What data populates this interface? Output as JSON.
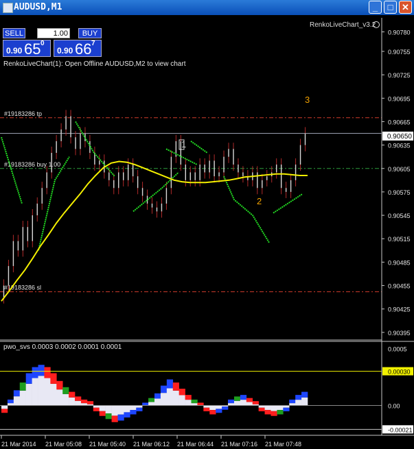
{
  "window": {
    "title": "AUDUSD,M1",
    "buttons": [
      "minimize",
      "maximize",
      "close"
    ]
  },
  "trade_panel": {
    "sell_label": "SELL",
    "buy_label": "BUY",
    "lots": "1.00",
    "sell_quote": {
      "small": "0.90",
      "big": "65",
      "sup": "0"
    },
    "buy_quote": {
      "small": "0.90",
      "big": "66",
      "sup": "7"
    }
  },
  "main_chart": {
    "indicator_label": "RenkoLiveChart_v3.2",
    "info_text": "RenkoLiveChart(1): Open Offline AUDUSD,M2 to view chart",
    "lines": [
      {
        "label": "#19183286 tp",
        "price": 0.9067,
        "color": "#d23c2c",
        "style": "dash-dot"
      },
      {
        "label": "#19183286 buy 1.00",
        "price": 0.90605,
        "color": "#2e9e3e",
        "style": "dash-dot"
      },
      {
        "label": "#19183286 sl",
        "price": 0.90447,
        "color": "#d23c2c",
        "style": "dash-dot"
      },
      {
        "label": "",
        "price": 0.9065,
        "color": "#9aa0b0",
        "style": "solid"
      }
    ],
    "price_axis": [
      "0.90780",
      "0.90755",
      "0.90725",
      "0.90695",
      "0.90665",
      "0.90635",
      "0.90605",
      "0.90575",
      "0.90545",
      "0.90515",
      "0.90485",
      "0.90455",
      "0.90425",
      "0.90395"
    ],
    "current_price": "0.90650",
    "wave_labels": [
      "1",
      "2",
      "3"
    ],
    "ylim": [
      0.90387,
      0.90798
    ]
  },
  "sub_chart": {
    "label": "pwo_svs 0.0003 0.0002 0.0001 0.0001",
    "axis": [
      "0.0005",
      "0.00030",
      "0.00",
      "-0.00021"
    ],
    "ylim": [
      -0.00025,
      0.00055
    ]
  },
  "time_axis": [
    "21 Mar 2014",
    "21 Mar 05:08",
    "21 Mar 05:40",
    "21 Mar 06:12",
    "21 Mar 06:44",
    "21 Mar 07:16",
    "21 Mar 07:48"
  ],
  "colors": {
    "candle": "#b02a2a",
    "ma": "#f5f000",
    "trail": "#22dd22",
    "wave": "#f0a000",
    "hist_pos": "#e8e8f4",
    "hist_red": "#ff1e1e",
    "hist_blue": "#1e46ff",
    "hist_green": "#1e9e1e"
  },
  "chart_data": {
    "type": "line",
    "close": [
      0.90455,
      0.9048,
      0.90512,
      0.905,
      0.9053,
      0.90512,
      0.90545,
      0.9056,
      0.9058,
      0.906,
      0.90625,
      0.9064,
      0.90655,
      0.90672,
      0.90645,
      0.9063,
      0.9065,
      0.9064,
      0.90625,
      0.9061,
      0.90615,
      0.906,
      0.9059,
      0.9058,
      0.906,
      0.9059,
      0.9061,
      0.90595,
      0.9058,
      0.9057,
      0.9056,
      0.90555,
      0.9055,
      0.9056,
      0.9058,
      0.9062,
      0.9064,
      0.9061,
      0.9059,
      0.906,
      0.9059,
      0.9061,
      0.906,
      0.90615,
      0.90595,
      0.906,
      0.9062,
      0.9063,
      0.9061,
      0.906,
      0.90595,
      0.9059,
      0.906,
      0.9058,
      0.9059,
      0.90595,
      0.906,
      0.9061,
      0.9058,
      0.90575,
      0.9059,
      0.9061,
      0.90635,
      0.9065
    ],
    "ma": [
      0.90435,
      0.90448,
      0.90462,
      0.90475,
      0.9049,
      0.90506,
      0.9052,
      0.90535,
      0.90548,
      0.9056,
      0.90572,
      0.90585,
      0.90596,
      0.90606,
      0.90612,
      0.90614,
      0.90613,
      0.9061,
      0.90606,
      0.90602,
      0.90598,
      0.90594,
      0.9059,
      0.90588,
      0.90587,
      0.90587,
      0.90587,
      0.90588,
      0.90589,
      0.9059,
      0.90592,
      0.90594,
      0.90595,
      0.90596,
      0.90597,
      0.90598,
      0.90598,
      0.90597,
      0.90596,
      0.90596
    ],
    "trail_segments": [
      [
        [
          0,
          0.90645
        ],
        [
          7,
          0.90585
        ],
        [
          10,
          0.9056
        ]
      ],
      [
        [
          18,
          0.905
        ],
        [
          26,
          0.9059
        ],
        [
          33,
          0.9062
        ]
      ],
      [
        [
          36,
          0.90665
        ],
        [
          45,
          0.90625
        ],
        [
          55,
          0.90595
        ]
      ],
      [
        [
          64,
          0.9055
        ],
        [
          78,
          0.9058
        ],
        [
          86,
          0.906
        ]
      ],
      [
        [
          80,
          0.9063
        ],
        [
          95,
          0.9061
        ]
      ],
      [
        [
          92,
          0.9064
        ],
        [
          100,
          0.90625
        ]
      ],
      [
        [
          108,
          0.90595
        ],
        [
          113,
          0.90565
        ],
        [
          122,
          0.90545
        ],
        [
          130,
          0.9051
        ]
      ],
      [
        [
          132,
          0.90548
        ],
        [
          146,
          0.90572
        ]
      ]
    ],
    "pwo": [
      -3e-05,
      2e-05,
      8e-05,
      0.00013,
      0.00019,
      0.00024,
      0.00026,
      0.00024,
      0.00019,
      0.00014,
      0.0001,
      7e-05,
      4e-05,
      2e-05,
      1e-05,
      -2e-05,
      -5e-05,
      -7e-05,
      -9e-05,
      -8e-05,
      -6e-05,
      -4e-05,
      -2e-05,
      0.0,
      3e-05,
      6e-05,
      0.00011,
      0.00015,
      0.00013,
      9e-05,
      5e-05,
      2e-05,
      0.0,
      -2e-05,
      -4e-05,
      -3e-05,
      -1e-05,
      2e-05,
      4e-05,
      5e-05,
      3e-05,
      1e-05,
      -2e-05,
      -4e-05,
      -5e-05,
      -4e-05,
      -2e-05,
      2e-05,
      5e-05,
      7e-05
    ]
  }
}
